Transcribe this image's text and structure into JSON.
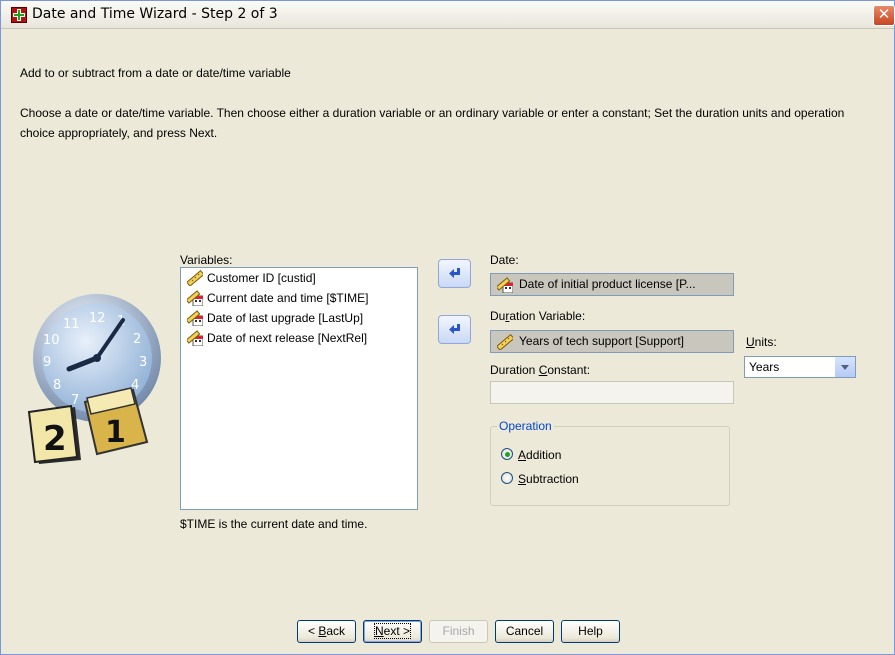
{
  "window": {
    "title": "Date and Time Wizard - Step 2 of 3",
    "close_glyph": "✕"
  },
  "intro": "Add to or subtract from a date or date/time variable",
  "description": "Choose a date or date/time variable. Then choose either a duration variable or an ordinary variable or enter a constant; Set the duration units and operation choice appropriately, and press Next.",
  "variables": {
    "label": "Variables:",
    "items": [
      {
        "label": "Customer ID [custid]",
        "icon": "ruler-icon"
      },
      {
        "label": "Current date and time [$TIME]",
        "icon": "calendar-date-icon"
      },
      {
        "label": "Date of last upgrade [LastUp]",
        "icon": "calendar-date-icon"
      },
      {
        "label": "Date of next release [NextRel]",
        "icon": "calendar-date-icon"
      }
    ],
    "footnote": "$TIME is the current date and time."
  },
  "date": {
    "label": "Date:",
    "value": "Date of initial product license [P..."
  },
  "duration_variable": {
    "label": "Duration Variable:",
    "value": "Years of tech support [Support]"
  },
  "units": {
    "label": "Units:",
    "selected": "Years"
  },
  "duration_constant": {
    "label": "Duration Constant:",
    "value": ""
  },
  "operation": {
    "legend": "Operation",
    "options": [
      {
        "label": "Addition",
        "selected": true
      },
      {
        "label": "Subtraction",
        "selected": false
      }
    ]
  },
  "buttons": {
    "back": "< Back",
    "next": "Next >",
    "finish": "Finish",
    "cancel": "Cancel",
    "help": "Help"
  },
  "colors": {
    "accent": "#0046d5",
    "dialog_background": "#ece9d8",
    "selection_field": "#c8c6bd"
  }
}
